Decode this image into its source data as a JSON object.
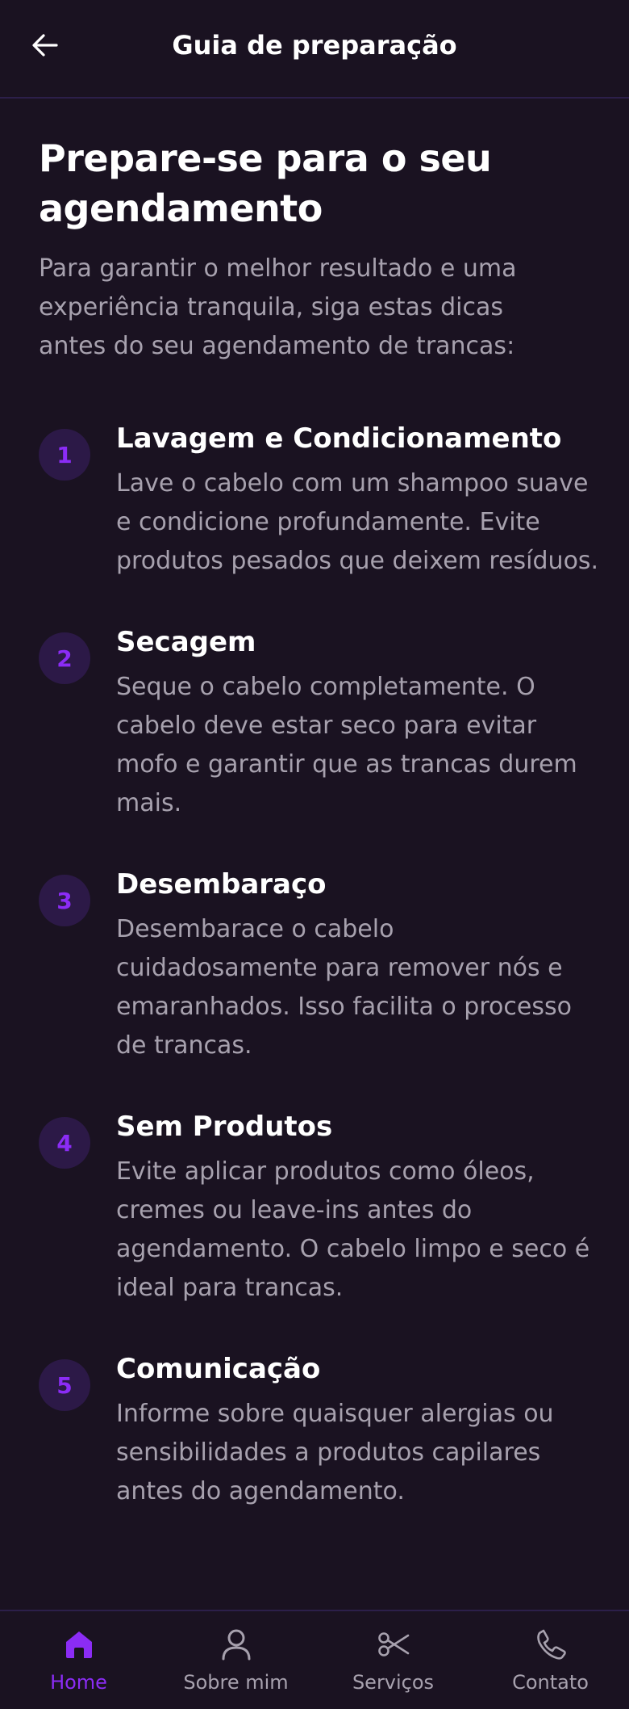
{
  "header": {
    "title": "Guia de preparação"
  },
  "page": {
    "title": "Prepare-se para o seu agendamento",
    "intro": "Para garantir o melhor resultado e uma experiência tranquila, siga estas dicas antes do seu agendamento de trancas:"
  },
  "steps": [
    {
      "number": "1",
      "title": "Lavagem e Condicionamento",
      "text": "Lave o cabelo com um shampoo suave e condicione profundamente. Evite produtos pesados que deixem resíduos."
    },
    {
      "number": "2",
      "title": "Secagem",
      "text": "Seque o cabelo completamente. O cabelo deve estar seco para evitar mofo e garantir que as trancas durem mais."
    },
    {
      "number": "3",
      "title": "Desembaraço",
      "text": "Desembarace o cabelo cuidadosamente para remover nós e emaranhados. Isso facilita o processo de trancas."
    },
    {
      "number": "4",
      "title": "Sem Produtos",
      "text": "Evite aplicar produtos como óleos, cremes ou leave-ins antes do agendamento. O cabelo limpo e seco é ideal para trancas."
    },
    {
      "number": "5",
      "title": "Comunicação",
      "text": "Informe sobre quaisquer alergias ou sensibilidades a produtos capilares antes do agendamento."
    }
  ],
  "nav": {
    "items": [
      {
        "label": "Home",
        "icon": "home-icon",
        "active": true
      },
      {
        "label": "Sobre mim",
        "icon": "user-icon",
        "active": false
      },
      {
        "label": "Serviços",
        "icon": "scissors-icon",
        "active": false
      },
      {
        "label": "Contato",
        "icon": "phone-icon",
        "active": false
      }
    ]
  },
  "colors": {
    "background": "#1a1221",
    "accent": "#8b2cf5",
    "muted_text": "#a7a1ae",
    "badge_bg": "#2c1947"
  }
}
